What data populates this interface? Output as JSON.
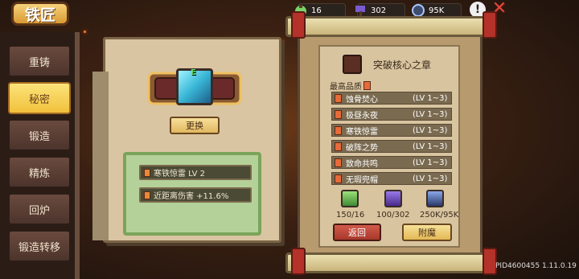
{
  "header": {
    "title": "铁匠",
    "resources": [
      {
        "icon": "potion-icon",
        "value": "16"
      },
      {
        "icon": "hammer-icon",
        "value": "302"
      },
      {
        "icon": "gear-coin-icon",
        "value": "95K"
      }
    ]
  },
  "sidebar": {
    "items": [
      {
        "label": "重铸"
      },
      {
        "label": "秘密",
        "active": true
      },
      {
        "label": "锻造"
      },
      {
        "label": "精炼"
      },
      {
        "label": "回炉"
      },
      {
        "label": "锻造转移"
      }
    ]
  },
  "left_book": {
    "item_grade": "E",
    "change_button": "更换",
    "skill_name": "寒铁惊雷 LV 2",
    "skill_effect": "近距离伤害 +11.6%"
  },
  "right_book": {
    "title": "突破核心之章",
    "quality_label": "最高品质",
    "list": [
      {
        "name": "蚀骨焚心",
        "level": "(LV 1~3)"
      },
      {
        "name": "极昼永夜",
        "level": "(LV 1~3)"
      },
      {
        "name": "寒铁惊雷",
        "level": "(LV 1~3)"
      },
      {
        "name": "破阵之势",
        "level": "(LV 1~3)"
      },
      {
        "name": "致命共鸣",
        "level": "(LV 1~3)"
      },
      {
        "name": "无瑕兜帽",
        "level": "(LV 1~3)"
      }
    ],
    "materials": [
      {
        "icon": "potion-icon",
        "value": "150/16"
      },
      {
        "icon": "hammer-icon",
        "value": "100/302"
      },
      {
        "icon": "gear-coin-icon",
        "value": "250K/95K"
      }
    ],
    "back_button": "返回",
    "enchant_button": "附魔"
  },
  "footer": {
    "pid": "PID4600455 1.11.0.19"
  },
  "colors": {
    "accent": "#f2c13c",
    "panel": "#d8c49f",
    "danger": "#a8382c"
  }
}
